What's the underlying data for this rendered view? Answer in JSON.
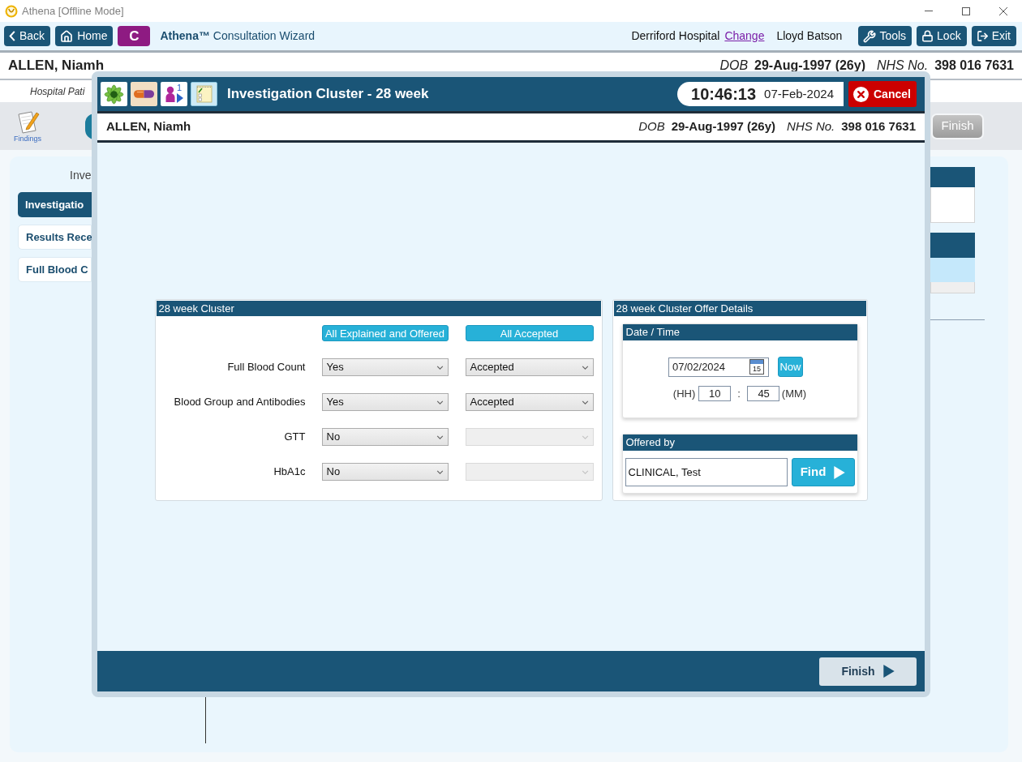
{
  "window": {
    "title": "Athena [Offline Mode]"
  },
  "toolbar": {
    "left_buttons": [
      {
        "kind": "back",
        "label": "Back"
      },
      {
        "kind": "home",
        "label": "Home"
      },
      {
        "kind": "context",
        "label": "C"
      }
    ],
    "app_title": "**Athena™** Consultation Wizard",
    "location": "Derriford Hospital",
    "change_link": "Change",
    "user": "Lloyd Batson",
    "right_buttons": [
      {
        "kind": "tools",
        "label": "Tools"
      },
      {
        "kind": "lock",
        "label": "Lock"
      },
      {
        "kind": "exit",
        "label": "Exit"
      }
    ]
  },
  "patient_banner": {
    "name": "ALLEN, Niamh",
    "dob_label": "DOB",
    "dob": "29-Aug-1997 (26y)",
    "nhs_label": "NHS No.",
    "nhs_number": "398 016 7631"
  },
  "subheader": {
    "text": "Hospital Pati"
  },
  "step_bar": {
    "findings_label": "Findings",
    "finish_button": {
      "label": "Finish",
      "disabled": true
    }
  },
  "main_panel": {
    "heading": "Inve",
    "nav_items": [
      {
        "label": "Investigatio",
        "selected": true
      },
      {
        "label": "Results Rece",
        "selected": false
      },
      {
        "label": "Full Blood C",
        "selected": false
      }
    ]
  },
  "dialog": {
    "header_icons": [
      {
        "kind": "flower"
      },
      {
        "kind": "pill"
      },
      {
        "kind": "queue",
        "badge": "1"
      },
      {
        "kind": "notepad"
      }
    ],
    "title": "Investigation Cluster - 28 week",
    "clock": {
      "time": "10:46:13",
      "date": "07-Feb-2024"
    },
    "cancel_button": "Cancel",
    "patient_banner": {
      "name": "ALLEN, Niamh",
      "dob_label": "DOB",
      "dob": "29-Aug-1997 (26y)",
      "nhs_label": "NHS No.",
      "nhs_number": "398 016 7631"
    },
    "cluster_panel": {
      "title": "28 week Cluster",
      "bulk_buttons": [
        "All Explained and Offered",
        "All Accepted"
      ],
      "rows": [
        {
          "label": "Full Blood Count",
          "offered": "Yes",
          "outcome": "Accepted",
          "outcome_disabled": false
        },
        {
          "label": "Blood Group and Antibodies",
          "offered": "Yes",
          "outcome": "Accepted",
          "outcome_disabled": false
        },
        {
          "label": "GTT",
          "offered": "No",
          "outcome_disabled": true
        },
        {
          "label": "HbA1c",
          "offered": "No",
          "outcome_disabled": true
        }
      ]
    },
    "offer_panel": {
      "title": "28 week Cluster Offer Details",
      "date_time": {
        "title": "Date / Time",
        "date": "07/02/2024",
        "calendar_day": "15",
        "now_button": "Now",
        "hour_label": "(HH)",
        "hour": "10",
        "separator": ":",
        "minute": "45",
        "minute_label": "(MM)"
      },
      "offered_by": {
        "title": "Offered by",
        "value": "CLINICAL, Test",
        "find_button": "Find"
      }
    },
    "footer": {
      "finish_button": "Finish"
    }
  }
}
